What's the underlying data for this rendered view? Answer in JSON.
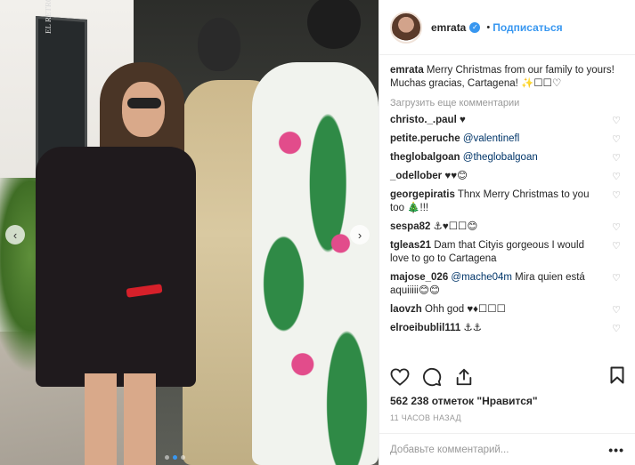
{
  "header": {
    "username": "emrata",
    "follow_label": "Подписаться",
    "separator": "•"
  },
  "caption": {
    "username": "emrata",
    "text": "Merry Christmas from our family to yours! Muchas gracias, Cartagena! ✨☐☐♡"
  },
  "load_more_label": "Загрузить еще комментарии",
  "comments": [
    {
      "username": "christo._.paul",
      "text": "♥"
    },
    {
      "username": "petite.peruche",
      "text": "@valentinefl",
      "mention": true
    },
    {
      "username": "theglobalgoan",
      "text": "@theglobalgoan",
      "mention": true
    },
    {
      "username": "_odellober",
      "text": "♥♥😊"
    },
    {
      "username": "georgepiratis",
      "text": "Thnx Merry Christmas to you too 🎄!!!"
    },
    {
      "username": "sespa82",
      "text": "⚓♥☐☐😊"
    },
    {
      "username": "tgleas21",
      "text": "Dam that Cityis gorgeous I would love to go to Cartagena"
    },
    {
      "username": "majose_026",
      "text": "@mache04m Mira quien está aquiiiii😊😊",
      "mention_part": "@mache04m",
      "rest": " Mira quien está aquiiiii😊😊"
    },
    {
      "username": "laovzh",
      "text": "Ohh god ♥♦☐☐☐"
    },
    {
      "username": "elroeibublil111",
      "text": "⚓⚓"
    }
  ],
  "likes": "562 238 отметок \"Нравится\"",
  "timestamp": "11 ЧАСОВ НАЗАД",
  "add_comment": {
    "placeholder": "Добавьте комментарий...",
    "more": "•••"
  },
  "photo": {
    "sign_text": "EL RETRO"
  },
  "colors": {
    "link": "#3897f0",
    "text": "#262626",
    "muted": "#999999",
    "border": "#efefef"
  },
  "icons": {
    "like": "heart-icon",
    "comment": "comment-icon",
    "share": "share-icon",
    "save": "bookmark-icon",
    "verified": "verified-badge-icon"
  }
}
